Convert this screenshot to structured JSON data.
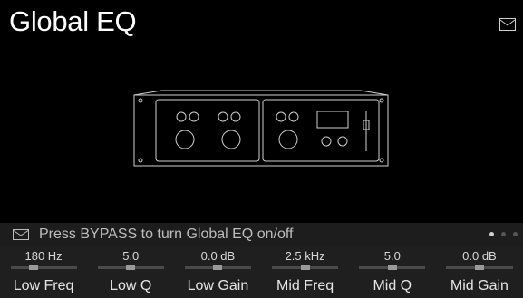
{
  "header": {
    "title": "Global EQ",
    "menu_icon": "envelope-icon"
  },
  "device_image": {
    "icon": "rack-device-icon"
  },
  "hint": {
    "icon": "envelope-icon",
    "text": "Press BYPASS to turn Global EQ on/off",
    "pages": {
      "count": 3,
      "active": 0
    }
  },
  "params": [
    {
      "label": "Low Freq",
      "value": "180 Hz",
      "level": 0.35
    },
    {
      "label": "Low Q",
      "value": "5.0",
      "level": 0.5
    },
    {
      "label": "Low Gain",
      "value": "0.0 dB",
      "level": 0.5
    },
    {
      "label": "Mid Freq",
      "value": "2.5 kHz",
      "level": 0.5
    },
    {
      "label": "Mid Q",
      "value": "5.0",
      "level": 0.5
    },
    {
      "label": "Mid Gain",
      "value": "0.0 dB",
      "level": 0.5
    }
  ],
  "colors": {
    "background": "#000000",
    "bar": "#1f1f1f",
    "text": "#ffffff"
  }
}
